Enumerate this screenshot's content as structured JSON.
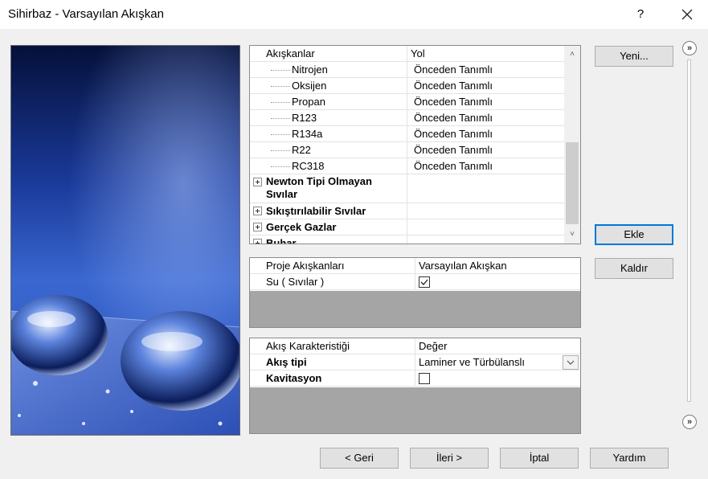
{
  "window": {
    "title": "Sihirbaz - Varsayılan Akışkan",
    "help_label": "?",
    "close_icon": "close-icon"
  },
  "fluids": {
    "header": [
      "Akışkanlar",
      "Yol"
    ],
    "children": [
      {
        "name": "Nitrojen",
        "path": "Önceden Tanımlı"
      },
      {
        "name": "Oksijen",
        "path": "Önceden Tanımlı"
      },
      {
        "name": "Propan",
        "path": "Önceden Tanımlı"
      },
      {
        "name": "R123",
        "path": "Önceden Tanımlı"
      },
      {
        "name": "R134a",
        "path": "Önceden Tanımlı"
      },
      {
        "name": "R22",
        "path": "Önceden Tanımlı"
      },
      {
        "name": "RC318",
        "path": "Önceden Tanımlı"
      }
    ],
    "groups": [
      {
        "line1": "Newton Tipi Olmayan",
        "line2": "Sıvılar"
      },
      {
        "line1": "Sıkıştırılabilir Sıvılar"
      },
      {
        "line1": "Gerçek Gazlar"
      },
      {
        "line1": "Buhar"
      }
    ]
  },
  "project": {
    "header": [
      "Proje Akışkanları",
      "Varsayılan Akışkan"
    ],
    "rows": [
      {
        "name": "Su ( Sıvılar )",
        "default_checked": true
      }
    ]
  },
  "flow": {
    "header": [
      "Akış Karakteristiği",
      "Değer"
    ],
    "type_label": "Akış tipi",
    "type_value": "Laminer ve Türbülanslı",
    "cavitation_label": "Kavitasyon",
    "cavitation_checked": false
  },
  "buttons": {
    "new": "Yeni...",
    "add": "Ekle",
    "remove": "Kaldır",
    "back": "< Geri",
    "next": "İleri >",
    "cancel": "İptal",
    "help": "Yardım"
  },
  "side_nav": {
    "top_icon": "chevron-double-right-icon",
    "bottom_icon": "chevron-double-right-icon"
  },
  "colors": {
    "focus_accent": "#0078d7",
    "panel_grey": "#a5a5a5"
  }
}
